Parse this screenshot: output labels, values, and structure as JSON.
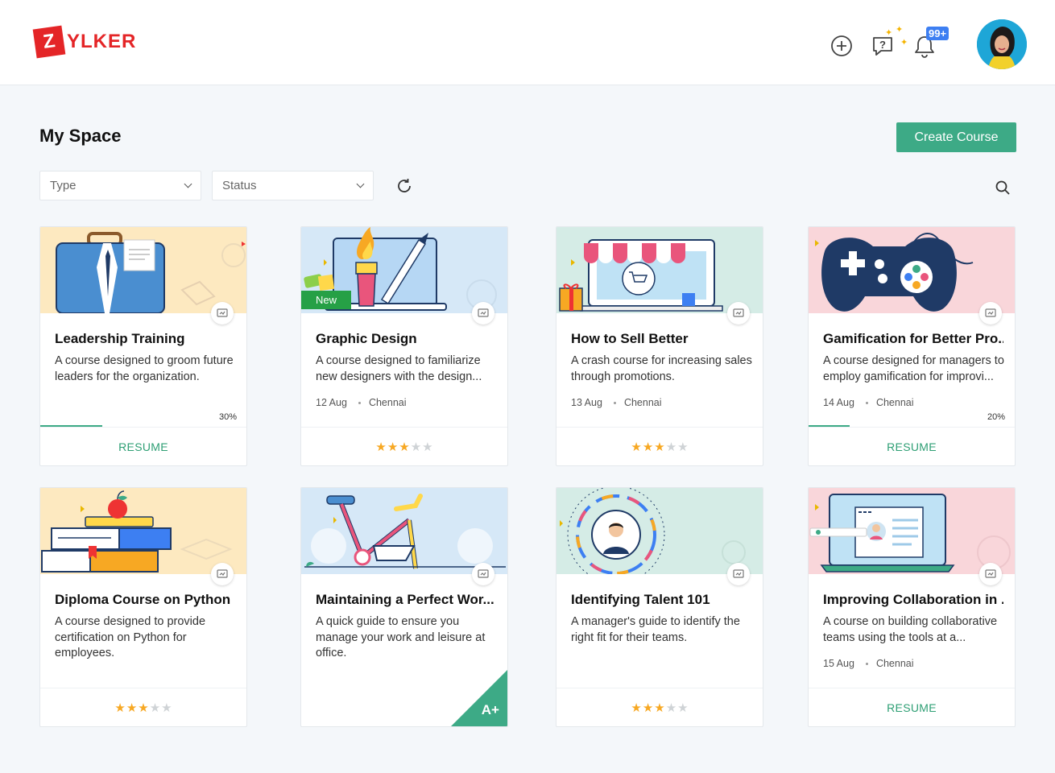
{
  "brand": {
    "logo_letter": "Z",
    "logo_rest": "YLKER",
    "color": "#e42527"
  },
  "header": {
    "icons": [
      "add-circle-icon",
      "help-chat-icon",
      "bell-icon"
    ],
    "notification_badge": "99+"
  },
  "page": {
    "title": "My Space",
    "create_button": "Create Course",
    "accent": "#3daa86"
  },
  "filters": {
    "type_placeholder": "Type",
    "status_placeholder": "Status"
  },
  "cards": [
    {
      "title": "Leadership Training",
      "description": "A course designed to groom future leaders for the organization.",
      "progress": 0.3,
      "progress_label": "30%",
      "action": "RESUME"
    },
    {
      "title": "Graphic Design",
      "description": "A course designed to familiarize new designers with the design...",
      "date": "12 Aug",
      "location": "Chennai",
      "tag": "New",
      "rating": 3
    },
    {
      "title": "How to Sell Better",
      "description": "A crash course for increasing sales through promotions.",
      "date": "13 Aug",
      "location": "Chennai",
      "rating": 3
    },
    {
      "title": "Gamification for Better Pro...",
      "description": "A course designed for managers to employ gamification for improvi...",
      "date": "14 Aug",
      "location": "Chennai",
      "progress": 0.2,
      "progress_label": "20%",
      "action": "RESUME"
    },
    {
      "title": "Diploma Course on Python",
      "description": "A course designed to provide certification on Python for employees.",
      "rating": 3
    },
    {
      "title": "Maintaining a Perfect Wor...",
      "description": "A quick guide to ensure you manage your work and leisure at office.",
      "grade": "A+"
    },
    {
      "title": "Identifying Talent 101",
      "description": "A manager's guide to identify the right fit for their teams.",
      "rating": 3
    },
    {
      "title": "Improving Collaboration in ...",
      "description": "A course on building collaborative teams using the tools at a...",
      "date": "15 Aug",
      "location": "Chennai",
      "action": "RESUME"
    }
  ]
}
